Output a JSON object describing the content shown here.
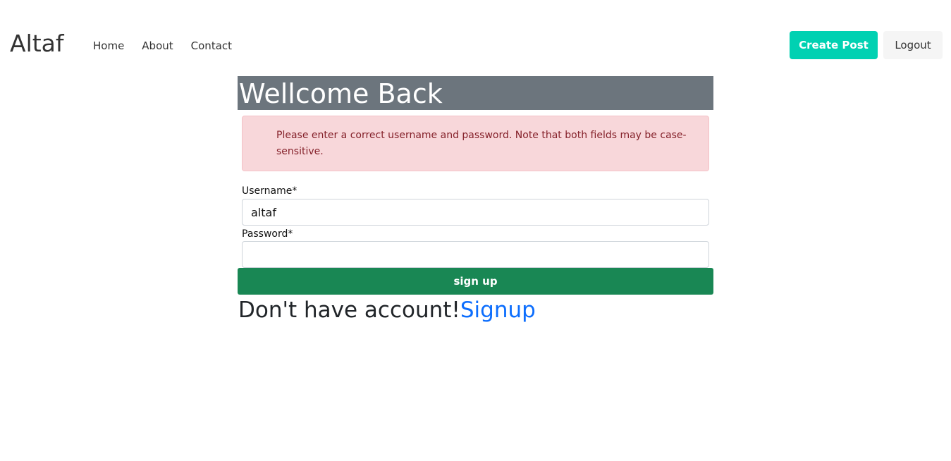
{
  "navbar": {
    "brand": "Altaf",
    "links": [
      "Home",
      "About",
      "Contact"
    ],
    "create_post_label": "Create Post",
    "logout_label": "Logout"
  },
  "login": {
    "title": "Wellcome Back",
    "error_message": "Please enter a correct username and password. Note that both fields may be case-sensitive.",
    "username_label": "Username*",
    "username_value": "altaf",
    "password_label": "Password*",
    "password_value": "",
    "submit_label": "sign up",
    "no_account_text": "Don't have account!",
    "signup_link": "Signup"
  },
  "colors": {
    "create_post_bg": "#00d1b2",
    "title_bar_bg": "#6c757d",
    "alert_bg": "#f8d7da",
    "alert_text": "#842029",
    "submit_bg": "#198754",
    "link": "#0d6efd"
  }
}
